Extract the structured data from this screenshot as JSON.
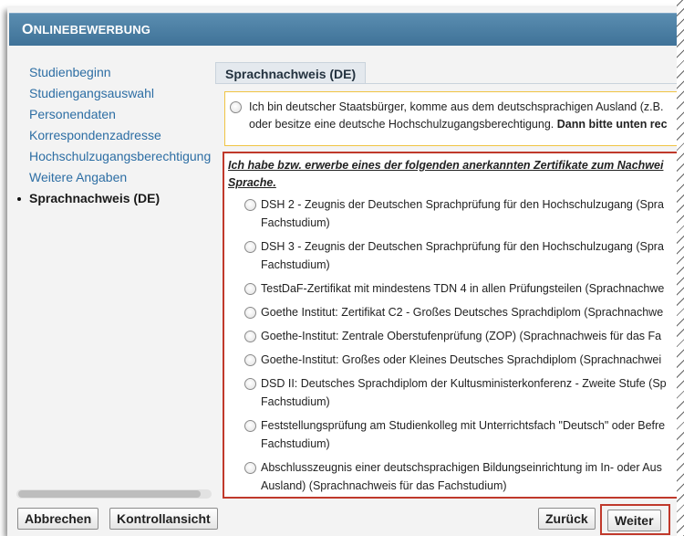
{
  "header": {
    "title_first": "O",
    "title_rest": "NLINEBEWERBUNG"
  },
  "sidebar": {
    "items": [
      {
        "label": "Studienbeginn"
      },
      {
        "label": "Studiengangsauswahl"
      },
      {
        "label": "Personendaten"
      },
      {
        "label": "Korrespondenzadresse"
      },
      {
        "label": "Hochschulzugangsberechtigung"
      },
      {
        "label": "Weitere Angaben"
      },
      {
        "label": "Sprachnachweis (DE)"
      }
    ],
    "active_index": 6
  },
  "section": {
    "tab_label": "Sprachnachweis (DE)"
  },
  "native_option": {
    "line1": "Ich bin deutscher Staatsbürger, komme aus dem deutschsprachigen Ausland (z.B.",
    "line2_normal": "oder besitze eine deutsche Hochschulzugangsberechtigung. ",
    "line2_bold": "Dann bitte unten rec"
  },
  "certificates": {
    "heading_line1": "Ich habe bzw. erwerbe eines der folgenden anerkannten Zertifikate zum Nachwei",
    "heading_line2": "Sprache.",
    "items": [
      {
        "line1": "DSH 2 - Zeugnis der Deutschen Sprachprüfung für den Hochschulzugang (Spra",
        "line2": "Fachstudium)"
      },
      {
        "line1": "DSH 3 - Zeugnis der Deutschen Sprachprüfung für den Hochschulzugang (Spra",
        "line2": "Fachstudium)"
      },
      {
        "line1": "TestDaF-Zertifikat mit mindestens TDN 4 in allen Prüfungsteilen (Sprachnachwe",
        "line2": ""
      },
      {
        "line1": "Goethe Institut: Zertifikat C2 - Großes Deutsches Sprachdiplom (Sprachnachwe",
        "line2": ""
      },
      {
        "line1": "Goethe-Institut: Zentrale Oberstufenprüfung (ZOP) (Sprachnachweis für das Fa",
        "line2": ""
      },
      {
        "line1": "Goethe-Institut: Großes oder Kleines Deutsches Sprachdiplom (Sprachnachwei",
        "line2": ""
      },
      {
        "line1": "DSD II: Deutsches Sprachdiplom der Kultusministerkonferenz - Zweite Stufe (Sp",
        "line2": "Fachstudium)"
      },
      {
        "line1": "Feststellungsprüfung am Studienkolleg mit Unterrichtsfach \"Deutsch\" oder Befre",
        "line2": "Fachstudium)"
      },
      {
        "line1": "Abschlusszeugnis einer deutschsprachigen Bildungseinrichtung im In- oder Aus",
        "line2": "Ausland) (Sprachnachweis für das Fachstudium)"
      }
    ]
  },
  "footer": {
    "cancel_label": "Abbrechen",
    "preview_label": "Kontrollansicht",
    "back_label": "Zurück",
    "next_label": "Weiter"
  }
}
